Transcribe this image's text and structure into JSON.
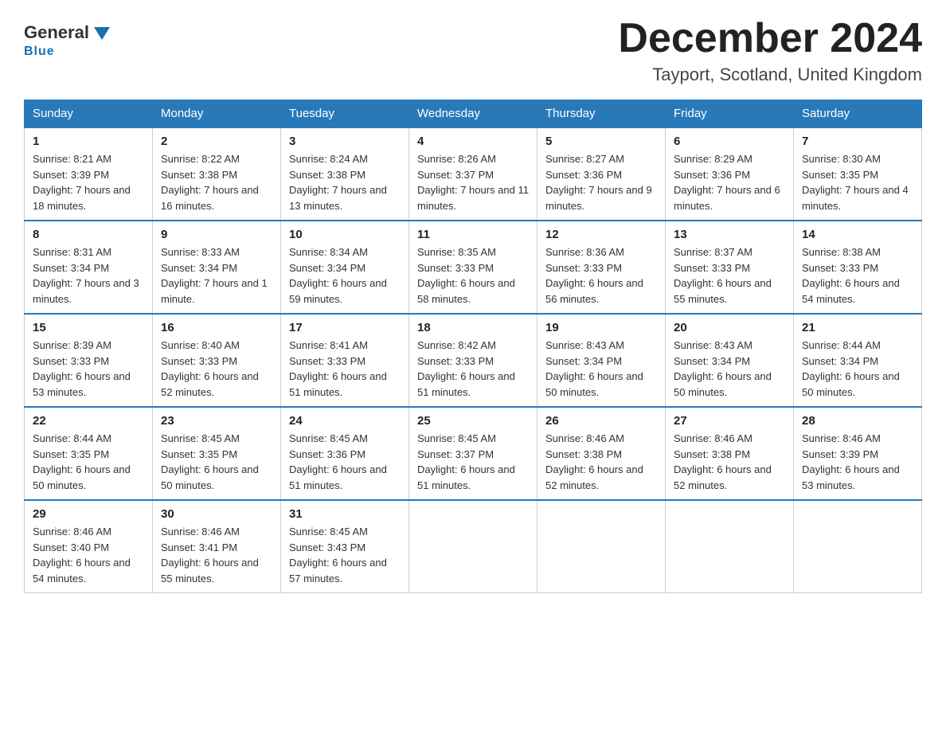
{
  "header": {
    "logo_general": "General",
    "logo_blue": "Blue",
    "month_title": "December 2024",
    "location": "Tayport, Scotland, United Kingdom"
  },
  "weekdays": [
    "Sunday",
    "Monday",
    "Tuesday",
    "Wednesday",
    "Thursday",
    "Friday",
    "Saturday"
  ],
  "weeks": [
    [
      {
        "day": 1,
        "sunrise": "8:21 AM",
        "sunset": "3:39 PM",
        "daylight": "7 hours and 18 minutes."
      },
      {
        "day": 2,
        "sunrise": "8:22 AM",
        "sunset": "3:38 PM",
        "daylight": "7 hours and 16 minutes."
      },
      {
        "day": 3,
        "sunrise": "8:24 AM",
        "sunset": "3:38 PM",
        "daylight": "7 hours and 13 minutes."
      },
      {
        "day": 4,
        "sunrise": "8:26 AM",
        "sunset": "3:37 PM",
        "daylight": "7 hours and 11 minutes."
      },
      {
        "day": 5,
        "sunrise": "8:27 AM",
        "sunset": "3:36 PM",
        "daylight": "7 hours and 9 minutes."
      },
      {
        "day": 6,
        "sunrise": "8:29 AM",
        "sunset": "3:36 PM",
        "daylight": "7 hours and 6 minutes."
      },
      {
        "day": 7,
        "sunrise": "8:30 AM",
        "sunset": "3:35 PM",
        "daylight": "7 hours and 4 minutes."
      }
    ],
    [
      {
        "day": 8,
        "sunrise": "8:31 AM",
        "sunset": "3:34 PM",
        "daylight": "7 hours and 3 minutes."
      },
      {
        "day": 9,
        "sunrise": "8:33 AM",
        "sunset": "3:34 PM",
        "daylight": "7 hours and 1 minute."
      },
      {
        "day": 10,
        "sunrise": "8:34 AM",
        "sunset": "3:34 PM",
        "daylight": "6 hours and 59 minutes."
      },
      {
        "day": 11,
        "sunrise": "8:35 AM",
        "sunset": "3:33 PM",
        "daylight": "6 hours and 58 minutes."
      },
      {
        "day": 12,
        "sunrise": "8:36 AM",
        "sunset": "3:33 PM",
        "daylight": "6 hours and 56 minutes."
      },
      {
        "day": 13,
        "sunrise": "8:37 AM",
        "sunset": "3:33 PM",
        "daylight": "6 hours and 55 minutes."
      },
      {
        "day": 14,
        "sunrise": "8:38 AM",
        "sunset": "3:33 PM",
        "daylight": "6 hours and 54 minutes."
      }
    ],
    [
      {
        "day": 15,
        "sunrise": "8:39 AM",
        "sunset": "3:33 PM",
        "daylight": "6 hours and 53 minutes."
      },
      {
        "day": 16,
        "sunrise": "8:40 AM",
        "sunset": "3:33 PM",
        "daylight": "6 hours and 52 minutes."
      },
      {
        "day": 17,
        "sunrise": "8:41 AM",
        "sunset": "3:33 PM",
        "daylight": "6 hours and 51 minutes."
      },
      {
        "day": 18,
        "sunrise": "8:42 AM",
        "sunset": "3:33 PM",
        "daylight": "6 hours and 51 minutes."
      },
      {
        "day": 19,
        "sunrise": "8:43 AM",
        "sunset": "3:34 PM",
        "daylight": "6 hours and 50 minutes."
      },
      {
        "day": 20,
        "sunrise": "8:43 AM",
        "sunset": "3:34 PM",
        "daylight": "6 hours and 50 minutes."
      },
      {
        "day": 21,
        "sunrise": "8:44 AM",
        "sunset": "3:34 PM",
        "daylight": "6 hours and 50 minutes."
      }
    ],
    [
      {
        "day": 22,
        "sunrise": "8:44 AM",
        "sunset": "3:35 PM",
        "daylight": "6 hours and 50 minutes."
      },
      {
        "day": 23,
        "sunrise": "8:45 AM",
        "sunset": "3:35 PM",
        "daylight": "6 hours and 50 minutes."
      },
      {
        "day": 24,
        "sunrise": "8:45 AM",
        "sunset": "3:36 PM",
        "daylight": "6 hours and 51 minutes."
      },
      {
        "day": 25,
        "sunrise": "8:45 AM",
        "sunset": "3:37 PM",
        "daylight": "6 hours and 51 minutes."
      },
      {
        "day": 26,
        "sunrise": "8:46 AM",
        "sunset": "3:38 PM",
        "daylight": "6 hours and 52 minutes."
      },
      {
        "day": 27,
        "sunrise": "8:46 AM",
        "sunset": "3:38 PM",
        "daylight": "6 hours and 52 minutes."
      },
      {
        "day": 28,
        "sunrise": "8:46 AM",
        "sunset": "3:39 PM",
        "daylight": "6 hours and 53 minutes."
      }
    ],
    [
      {
        "day": 29,
        "sunrise": "8:46 AM",
        "sunset": "3:40 PM",
        "daylight": "6 hours and 54 minutes."
      },
      {
        "day": 30,
        "sunrise": "8:46 AM",
        "sunset": "3:41 PM",
        "daylight": "6 hours and 55 minutes."
      },
      {
        "day": 31,
        "sunrise": "8:45 AM",
        "sunset": "3:43 PM",
        "daylight": "6 hours and 57 minutes."
      },
      null,
      null,
      null,
      null
    ]
  ]
}
